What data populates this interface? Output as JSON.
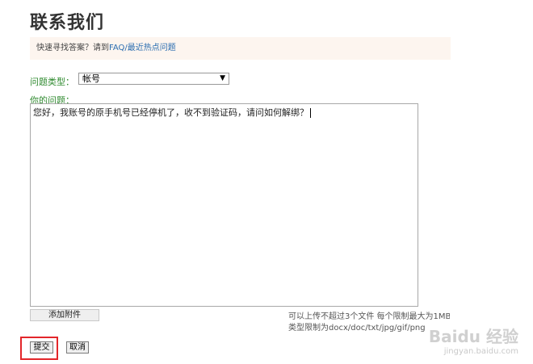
{
  "page": {
    "title": "联系我们"
  },
  "faq": {
    "prefix": "快速寻找答案？请到",
    "link": "FAQ/最近热点问题"
  },
  "form": {
    "qtype_label": "问题类型：",
    "qtype_selected": "帐号",
    "question_label": "你的问题：",
    "question_text": "您好，我账号的原手机号已经停机了，收不到验证码，请问如何解绑？",
    "attach_label": "添加附件",
    "hint_line1": "可以上传不超过3个文件 每个限制最大为1MB",
    "hint_line2": "类型限制为docx/doc/txt/jpg/gif/png",
    "submit_label": "提交",
    "cancel_label": "取消"
  },
  "watermark": {
    "main": "Baidu 经验",
    "sub": "jingyan.baidu.com"
  },
  "colors": {
    "highlight_border": "#e3262a",
    "label_green": "#2f8a2f",
    "link_blue": "#2a6db0"
  }
}
